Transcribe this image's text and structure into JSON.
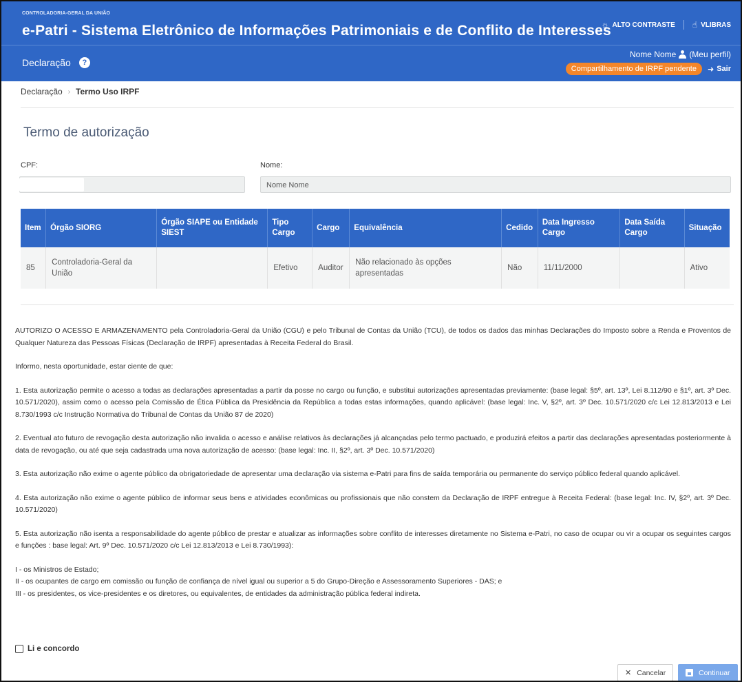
{
  "header": {
    "org": "CONTROLADORIA-GERAL DA UNIÃO",
    "title": "e-Patri - Sistema Eletrônico de Informações Patrimoniais e de Conflito de Interesses",
    "high_contrast": "ALTO CONTRASTE",
    "vlibras": "VLIBRAS",
    "brand_color": "#2f67c6"
  },
  "subheader": {
    "nav_label": "Declaração",
    "user_name": "Nome Nome",
    "profile_link": "(Meu perfil)",
    "pending_badge": "Compartilhamento de IRPF pendente",
    "logout": "Sair",
    "badge_color": "#f4862a"
  },
  "breadcrumb": {
    "root": "Declaração",
    "current": "Termo Uso IRPF"
  },
  "page": {
    "title": "Termo de autorização"
  },
  "form": {
    "cpf_label": "CPF:",
    "cpf_value": "",
    "name_label": "Nome:",
    "name_value": "Nome Nome"
  },
  "table": {
    "headers": [
      "Item",
      "Órgão SIORG",
      "Órgão SIAPE ou Entidade SIEST",
      "Tipo Cargo",
      "Cargo",
      "Equivalência",
      "Cedido",
      "Data Ingresso Cargo",
      "Data Saída Cargo",
      "Situação"
    ],
    "rows": [
      [
        "85",
        "Controladoria-Geral da União",
        "",
        "Efetivo",
        "Auditor",
        "Não relacionado às opções apresentadas",
        "Não",
        "11/11/2000",
        "",
        "Ativo"
      ]
    ]
  },
  "terms": {
    "p0": "AUTORIZO O ACESSO E ARMAZENAMENTO pela Controladoria-Geral da União (CGU) e pelo Tribunal de Contas da União (TCU), de todos os dados das minhas Declarações do Imposto sobre a Renda e Proventos de Qualquer Natureza das Pessoas Físicas (Declaração de IRPF) apresentadas à Receita Federal do Brasil.",
    "p1": "Informo, nesta oportunidade, estar ciente de que:",
    "p2": "1. Esta autorização permite o acesso a todas as declarações apresentadas a partir da posse no cargo ou função, e substitui autorizações apresentadas previamente: (base legal: §5º, art. 13º, Lei 8.112/90 e §1º, art. 3º Dec. 10.571/2020), assim como o acesso pela Comissão de Ética Pública da Presidência da República a todas estas informações, quando aplicável: (base legal: Inc. V, §2º, art. 3º Dec. 10.571/2020 c/c Lei 12.813/2013 e Lei 8.730/1993 c/c Instrução Normativa do Tribunal de Contas da União 87 de 2020)",
    "p3": "2. Eventual ato futuro de revogação desta autorização não invalida o acesso e análise relativos às declarações já alcançadas pelo termo pactuado, e produzirá efeitos a partir das declarações apresentadas posteriormente à data de revogação, ou até que seja cadastrada uma nova autorização de acesso: (base legal: Inc. II, §2º, art. 3º Dec. 10.571/2020)",
    "p4": "3. Esta autorização não exime o agente público da obrigatoriedade de apresentar uma declaração via sistema e-Patri para fins de saída temporária ou permanente do serviço público federal quando aplicável.",
    "p5": "4. Esta autorização não exime o agente público de informar seus bens e atividades econômicas ou profissionais que não constem da Declaração de IRPF entregue à Receita Federal: (base legal: Inc. IV, §2º, art. 3º Dec. 10.571/2020)",
    "p6": "5. Esta autorização não isenta a responsabilidade do agente público de prestar e atualizar as informações sobre conflito de interesses diretamente no Sistema e-Patri, no caso de ocupar ou vir a ocupar os seguintes cargos e funções : base legal: Art. 9º Dec. 10.571/2020 c/c Lei 12.813/2013 e Lei 8.730/1993):",
    "l1": "I - os Ministros de Estado;",
    "l2": "II - os ocupantes de cargo em comissão ou função de confiança de nível igual ou superior a 5 do Grupo-Direção e Assessoramento Superiores - DAS; e",
    "l3": "III - os presidentes, os vice-presidentes e os diretores, ou equivalentes, de entidades da administração pública federal indireta."
  },
  "agree_label": "Li e concordo",
  "buttons": {
    "cancel": "Cancelar",
    "continue": "Continuar"
  }
}
